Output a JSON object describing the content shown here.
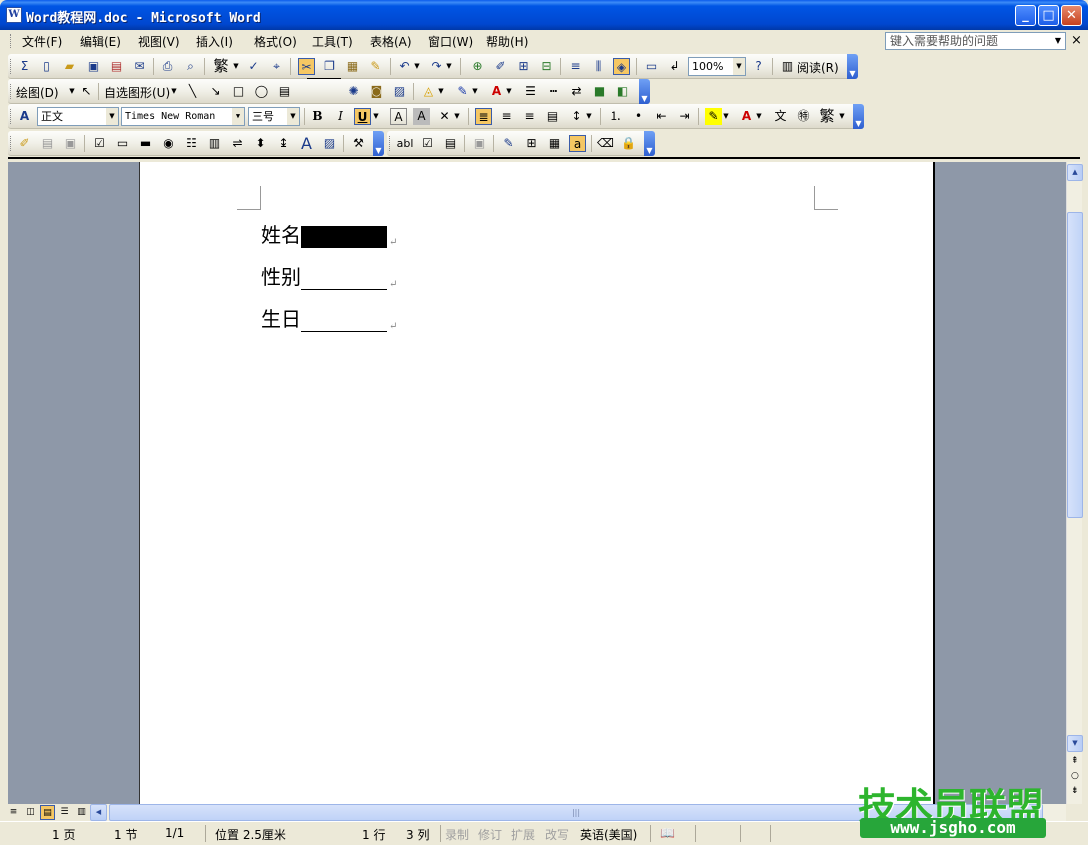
{
  "window": {
    "title": "Word教程网.doc - Microsoft Word",
    "app_icon": "word-doc-icon",
    "minimize": "_",
    "maximize": "□",
    "close": "✕"
  },
  "menubar": {
    "items": [
      "文件(F)",
      "编辑(E)",
      "视图(V)",
      "插入(I)",
      "格式(O)",
      "工具(T)",
      "表格(A)",
      "窗口(W)",
      "帮助(H)"
    ],
    "help_placeholder": "键入需要帮助的问题",
    "close": "×"
  },
  "toolbar_standard": {
    "zoom": "100%",
    "read_label": "阅读(R)",
    "traditional_label": "繁"
  },
  "tooltip": {
    "text": "剪切"
  },
  "toolbar_drawing": {
    "draw_label": "绘图(D)",
    "autoshapes_label": "自选图形(U)"
  },
  "toolbar_formatting": {
    "style": "正文",
    "font": "Times New Roman",
    "size": "三号",
    "bold": "B",
    "italic": "I",
    "underline": "U",
    "traditional": "繁"
  },
  "toolbar_forms": {
    "text_field": "abl"
  },
  "document": {
    "lines": [
      {
        "label": "姓名",
        "selected": true
      },
      {
        "label": "性别",
        "selected": false
      },
      {
        "label": "生日",
        "selected": false
      }
    ]
  },
  "statusbar": {
    "page": "1 页",
    "section": "1 节",
    "page_of": "1/1",
    "position": "位置 2.5厘米",
    "line": "1 行",
    "column": "3 列",
    "rec": "录制",
    "trk": "修订",
    "ext": "扩展",
    "ovr": "改写",
    "language": "英语(美国)"
  },
  "watermark": {
    "brand": "技术员联盟",
    "url": "www.jsgho.com"
  },
  "colors": {
    "title_blue": "#0055E5",
    "selection": "#000000",
    "watermark_green": "#2DB52D",
    "highlight": "#F5C763"
  }
}
